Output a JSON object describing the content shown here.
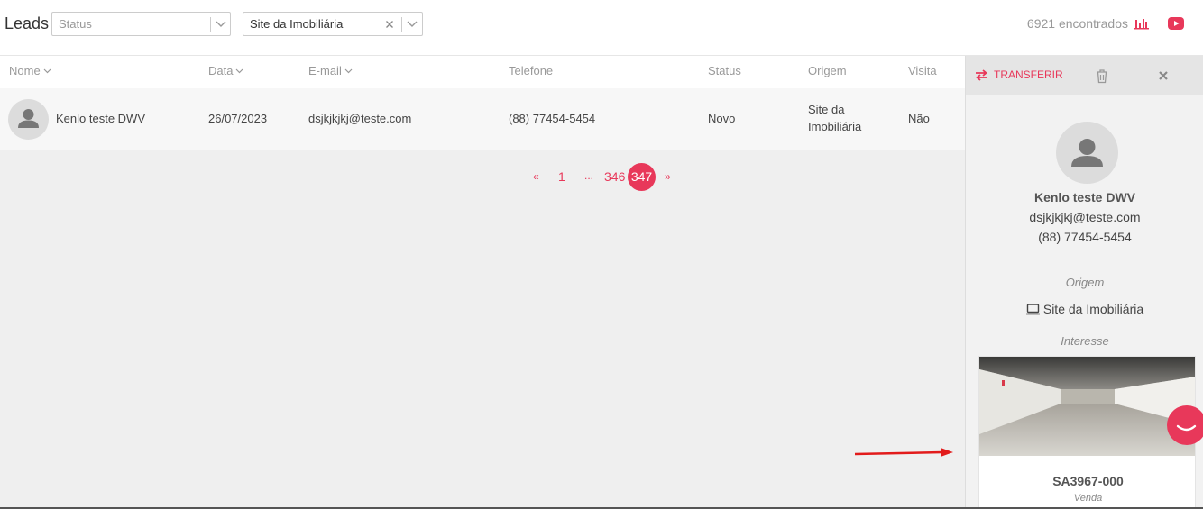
{
  "header": {
    "title": "Leads",
    "status_filter": {
      "placeholder": "Status"
    },
    "origin_filter": {
      "value": "Site da Imobiliária"
    },
    "found_text": "6921 encontrados"
  },
  "table": {
    "columns": [
      "Nome",
      "Data",
      "E-mail",
      "Telefone",
      "Status",
      "Origem",
      "Visita"
    ],
    "rows": [
      {
        "nome": "Kenlo teste DWV",
        "data": "26/07/2023",
        "email": "dsjkjkjkj@teste.com",
        "telefone": "(88) 77454-5454",
        "status": "Novo",
        "origem_line1": "Site da",
        "origem_line2": "Imobiliária",
        "visita": "Não"
      }
    ]
  },
  "pagination": {
    "prev": "«",
    "first": "1",
    "ellipsis": "...",
    "prev_page": "346",
    "current": "347",
    "next": "»"
  },
  "panel": {
    "transfer_label": "TRANSFERIR",
    "name": "Kenlo teste DWV",
    "email": "dsjkjkjkj@teste.com",
    "phone": "(88) 77454-5454",
    "origin_label": "Origem",
    "origin_value": "Site da Imobiliária",
    "interest_label": "Interesse",
    "property": {
      "ref": "SA3967-000",
      "deal": "Venda"
    }
  },
  "colors": {
    "accent": "#e8385a",
    "muted": "#999999"
  },
  "icons": [
    "chevron-down-icon",
    "clear-icon",
    "chart-icon",
    "youtube-icon",
    "transfer-icon",
    "trash-icon",
    "close-icon",
    "user-icon",
    "monitor-icon",
    "chat-icon"
  ]
}
